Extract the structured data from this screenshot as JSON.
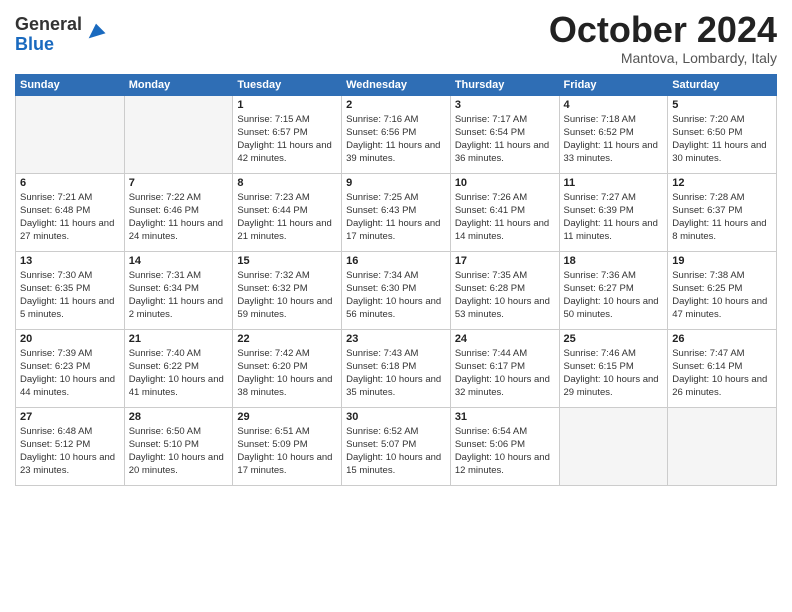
{
  "logo": {
    "general": "General",
    "blue": "Blue"
  },
  "header": {
    "month": "October 2024",
    "location": "Mantova, Lombardy, Italy"
  },
  "weekdays": [
    "Sunday",
    "Monday",
    "Tuesday",
    "Wednesday",
    "Thursday",
    "Friday",
    "Saturday"
  ],
  "weeks": [
    [
      {
        "day": "",
        "empty": true
      },
      {
        "day": "",
        "empty": true
      },
      {
        "day": "1",
        "sunrise": "Sunrise: 7:15 AM",
        "sunset": "Sunset: 6:57 PM",
        "daylight": "Daylight: 11 hours and 42 minutes."
      },
      {
        "day": "2",
        "sunrise": "Sunrise: 7:16 AM",
        "sunset": "Sunset: 6:56 PM",
        "daylight": "Daylight: 11 hours and 39 minutes."
      },
      {
        "day": "3",
        "sunrise": "Sunrise: 7:17 AM",
        "sunset": "Sunset: 6:54 PM",
        "daylight": "Daylight: 11 hours and 36 minutes."
      },
      {
        "day": "4",
        "sunrise": "Sunrise: 7:18 AM",
        "sunset": "Sunset: 6:52 PM",
        "daylight": "Daylight: 11 hours and 33 minutes."
      },
      {
        "day": "5",
        "sunrise": "Sunrise: 7:20 AM",
        "sunset": "Sunset: 6:50 PM",
        "daylight": "Daylight: 11 hours and 30 minutes."
      }
    ],
    [
      {
        "day": "6",
        "sunrise": "Sunrise: 7:21 AM",
        "sunset": "Sunset: 6:48 PM",
        "daylight": "Daylight: 11 hours and 27 minutes."
      },
      {
        "day": "7",
        "sunrise": "Sunrise: 7:22 AM",
        "sunset": "Sunset: 6:46 PM",
        "daylight": "Daylight: 11 hours and 24 minutes."
      },
      {
        "day": "8",
        "sunrise": "Sunrise: 7:23 AM",
        "sunset": "Sunset: 6:44 PM",
        "daylight": "Daylight: 11 hours and 21 minutes."
      },
      {
        "day": "9",
        "sunrise": "Sunrise: 7:25 AM",
        "sunset": "Sunset: 6:43 PM",
        "daylight": "Daylight: 11 hours and 17 minutes."
      },
      {
        "day": "10",
        "sunrise": "Sunrise: 7:26 AM",
        "sunset": "Sunset: 6:41 PM",
        "daylight": "Daylight: 11 hours and 14 minutes."
      },
      {
        "day": "11",
        "sunrise": "Sunrise: 7:27 AM",
        "sunset": "Sunset: 6:39 PM",
        "daylight": "Daylight: 11 hours and 11 minutes."
      },
      {
        "day": "12",
        "sunrise": "Sunrise: 7:28 AM",
        "sunset": "Sunset: 6:37 PM",
        "daylight": "Daylight: 11 hours and 8 minutes."
      }
    ],
    [
      {
        "day": "13",
        "sunrise": "Sunrise: 7:30 AM",
        "sunset": "Sunset: 6:35 PM",
        "daylight": "Daylight: 11 hours and 5 minutes."
      },
      {
        "day": "14",
        "sunrise": "Sunrise: 7:31 AM",
        "sunset": "Sunset: 6:34 PM",
        "daylight": "Daylight: 11 hours and 2 minutes."
      },
      {
        "day": "15",
        "sunrise": "Sunrise: 7:32 AM",
        "sunset": "Sunset: 6:32 PM",
        "daylight": "Daylight: 10 hours and 59 minutes."
      },
      {
        "day": "16",
        "sunrise": "Sunrise: 7:34 AM",
        "sunset": "Sunset: 6:30 PM",
        "daylight": "Daylight: 10 hours and 56 minutes."
      },
      {
        "day": "17",
        "sunrise": "Sunrise: 7:35 AM",
        "sunset": "Sunset: 6:28 PM",
        "daylight": "Daylight: 10 hours and 53 minutes."
      },
      {
        "day": "18",
        "sunrise": "Sunrise: 7:36 AM",
        "sunset": "Sunset: 6:27 PM",
        "daylight": "Daylight: 10 hours and 50 minutes."
      },
      {
        "day": "19",
        "sunrise": "Sunrise: 7:38 AM",
        "sunset": "Sunset: 6:25 PM",
        "daylight": "Daylight: 10 hours and 47 minutes."
      }
    ],
    [
      {
        "day": "20",
        "sunrise": "Sunrise: 7:39 AM",
        "sunset": "Sunset: 6:23 PM",
        "daylight": "Daylight: 10 hours and 44 minutes."
      },
      {
        "day": "21",
        "sunrise": "Sunrise: 7:40 AM",
        "sunset": "Sunset: 6:22 PM",
        "daylight": "Daylight: 10 hours and 41 minutes."
      },
      {
        "day": "22",
        "sunrise": "Sunrise: 7:42 AM",
        "sunset": "Sunset: 6:20 PM",
        "daylight": "Daylight: 10 hours and 38 minutes."
      },
      {
        "day": "23",
        "sunrise": "Sunrise: 7:43 AM",
        "sunset": "Sunset: 6:18 PM",
        "daylight": "Daylight: 10 hours and 35 minutes."
      },
      {
        "day": "24",
        "sunrise": "Sunrise: 7:44 AM",
        "sunset": "Sunset: 6:17 PM",
        "daylight": "Daylight: 10 hours and 32 minutes."
      },
      {
        "day": "25",
        "sunrise": "Sunrise: 7:46 AM",
        "sunset": "Sunset: 6:15 PM",
        "daylight": "Daylight: 10 hours and 29 minutes."
      },
      {
        "day": "26",
        "sunrise": "Sunrise: 7:47 AM",
        "sunset": "Sunset: 6:14 PM",
        "daylight": "Daylight: 10 hours and 26 minutes."
      }
    ],
    [
      {
        "day": "27",
        "sunrise": "Sunrise: 6:48 AM",
        "sunset": "Sunset: 5:12 PM",
        "daylight": "Daylight: 10 hours and 23 minutes."
      },
      {
        "day": "28",
        "sunrise": "Sunrise: 6:50 AM",
        "sunset": "Sunset: 5:10 PM",
        "daylight": "Daylight: 10 hours and 20 minutes."
      },
      {
        "day": "29",
        "sunrise": "Sunrise: 6:51 AM",
        "sunset": "Sunset: 5:09 PM",
        "daylight": "Daylight: 10 hours and 17 minutes."
      },
      {
        "day": "30",
        "sunrise": "Sunrise: 6:52 AM",
        "sunset": "Sunset: 5:07 PM",
        "daylight": "Daylight: 10 hours and 15 minutes."
      },
      {
        "day": "31",
        "sunrise": "Sunrise: 6:54 AM",
        "sunset": "Sunset: 5:06 PM",
        "daylight": "Daylight: 10 hours and 12 minutes."
      },
      {
        "day": "",
        "empty": true
      },
      {
        "day": "",
        "empty": true
      }
    ]
  ]
}
